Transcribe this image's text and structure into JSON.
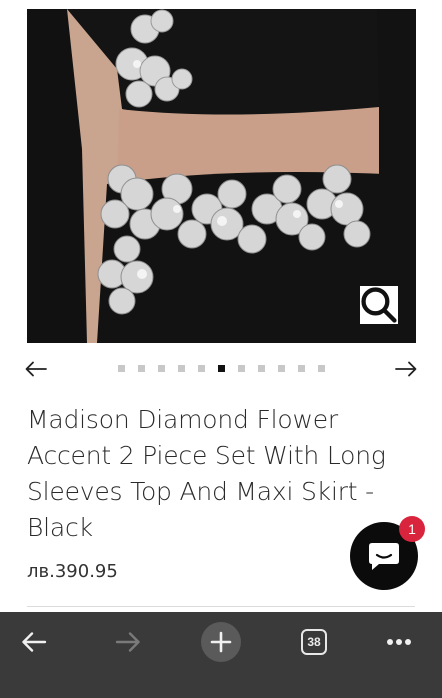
{
  "product": {
    "title": "Madison Diamond Flower Accent 2 Piece Set With Long Sleeves Top And Maxi Skirt - Black",
    "price": "лв.390.95"
  },
  "gallery": {
    "image_count": 11,
    "active_index": 5
  },
  "chat": {
    "unread_count": "1"
  },
  "browser_toolbar": {
    "tab_count": "38"
  },
  "colors": {
    "skin": "#c9a48f",
    "garment": "#111111",
    "crystal": "#d9d9d9",
    "toolbar_bg": "#3a3a3a",
    "badge": "#d8243c"
  }
}
